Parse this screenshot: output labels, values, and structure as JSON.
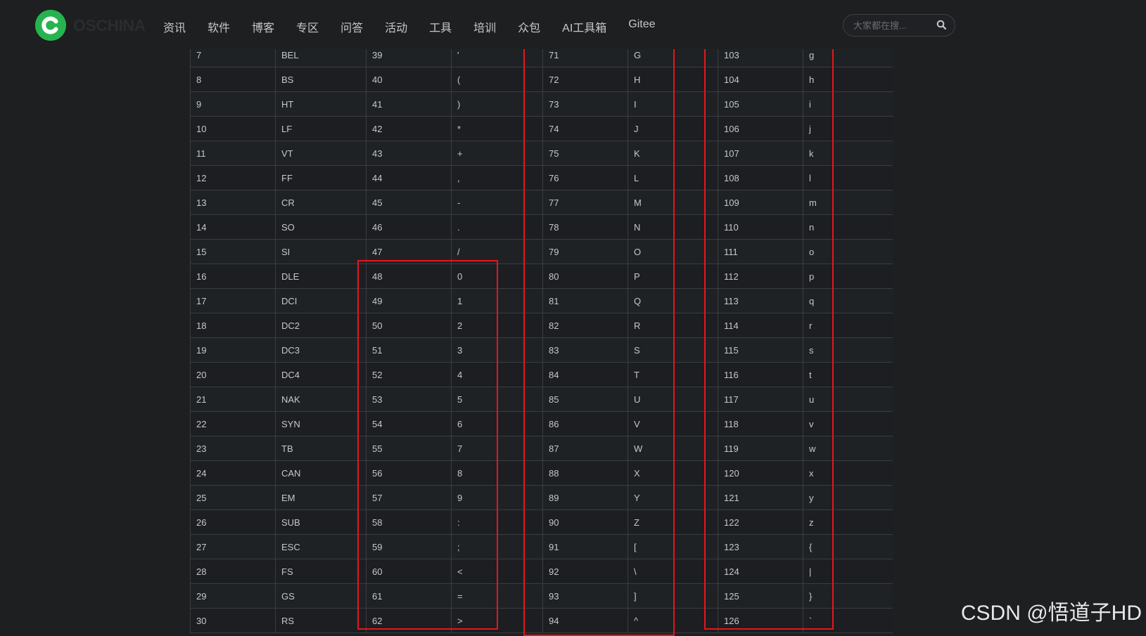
{
  "header": {
    "logo_text": "OSCHINA",
    "nav": [
      "资讯",
      "软件",
      "博客",
      "专区",
      "问答",
      "活动",
      "工具",
      "培训",
      "众包",
      "AI工具箱",
      "Gitee"
    ],
    "search_placeholder": "大家都在搜..."
  },
  "table": {
    "rows": [
      [
        "7",
        "BEL",
        "39",
        "'",
        "71",
        "G",
        "103",
        "g"
      ],
      [
        "8",
        "BS",
        "40",
        "(",
        "72",
        "H",
        "104",
        "h"
      ],
      [
        "9",
        "HT",
        "41",
        ")",
        "73",
        "I",
        "105",
        "i"
      ],
      [
        "10",
        "LF",
        "42",
        "*",
        "74",
        "J",
        "106",
        "j"
      ],
      [
        "11",
        "VT",
        "43",
        "+",
        "75",
        "K",
        "107",
        "k"
      ],
      [
        "12",
        "FF",
        "44",
        ",",
        "76",
        "L",
        "108",
        "l"
      ],
      [
        "13",
        "CR",
        "45",
        "-",
        "77",
        "M",
        "109",
        "m"
      ],
      [
        "14",
        "SO",
        "46",
        ".",
        "78",
        "N",
        "110",
        "n"
      ],
      [
        "15",
        "SI",
        "47",
        "/",
        "79",
        "O",
        "111",
        "o"
      ],
      [
        "16",
        "DLE",
        "48",
        "0",
        "80",
        "P",
        "112",
        "p"
      ],
      [
        "17",
        "DCI",
        "49",
        "1",
        "81",
        "Q",
        "113",
        "q"
      ],
      [
        "18",
        "DC2",
        "50",
        "2",
        "82",
        "R",
        "114",
        "r"
      ],
      [
        "19",
        "DC3",
        "51",
        "3",
        "83",
        "S",
        "115",
        "s"
      ],
      [
        "20",
        "DC4",
        "52",
        "4",
        "84",
        "T",
        "116",
        "t"
      ],
      [
        "21",
        "NAK",
        "53",
        "5",
        "85",
        "U",
        "117",
        "u"
      ],
      [
        "22",
        "SYN",
        "54",
        "6",
        "86",
        "V",
        "118",
        "v"
      ],
      [
        "23",
        "TB",
        "55",
        "7",
        "87",
        "W",
        "119",
        "w"
      ],
      [
        "24",
        "CAN",
        "56",
        "8",
        "88",
        "X",
        "120",
        "x"
      ],
      [
        "25",
        "EM",
        "57",
        "9",
        "89",
        "Y",
        "121",
        "y"
      ],
      [
        "26",
        "SUB",
        "58",
        ":",
        "90",
        "Z",
        "122",
        "z"
      ],
      [
        "27",
        "ESC",
        "59",
        ";",
        "91",
        "[",
        "123",
        "{"
      ],
      [
        "28",
        "FS",
        "60",
        "<",
        "92",
        "\\",
        "124",
        "|"
      ],
      [
        "29",
        "GS",
        "61",
        "=",
        "93",
        "]",
        "125",
        "}"
      ],
      [
        "30",
        "RS",
        "62",
        ">",
        "94",
        "^",
        "126",
        "`"
      ]
    ]
  },
  "watermark": "CSDN @悟道子HD",
  "colors": {
    "background": "#1d1f21",
    "logo_green": "#27b34f",
    "highlight_red": "#e5161d",
    "grid_line": "#3a3d41"
  }
}
